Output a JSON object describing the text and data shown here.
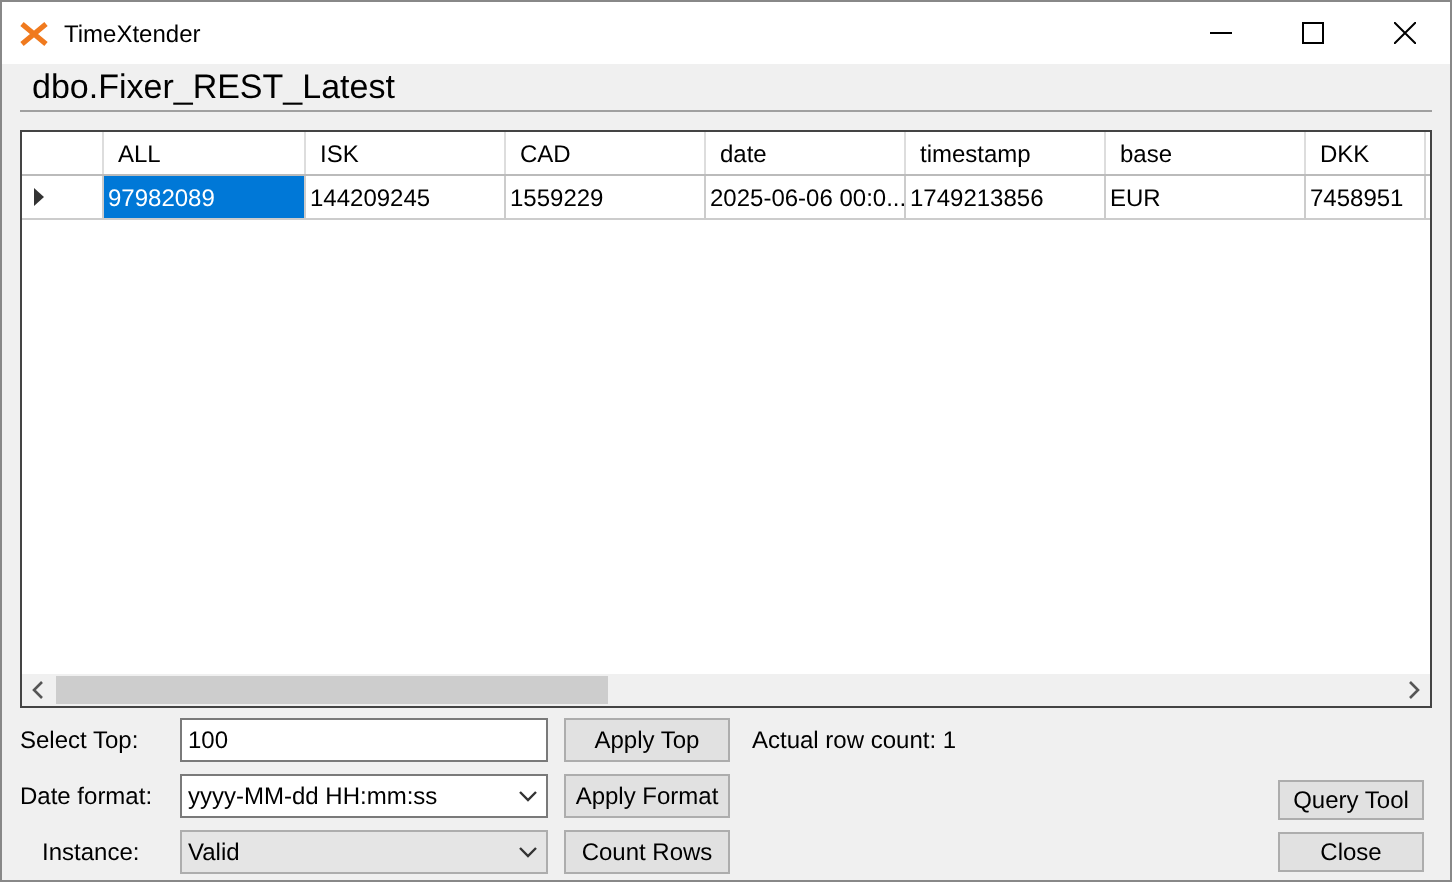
{
  "window": {
    "title": "TimeXtender"
  },
  "header": "dbo.Fixer_REST_Latest",
  "table": {
    "columns": [
      "ALL",
      "ISK",
      "CAD",
      "date",
      "timestamp",
      "base",
      "DKK"
    ],
    "rows": [
      {
        "current": true,
        "cells": [
          {
            "text": "97982089",
            "selected": true
          },
          {
            "text": "144209245",
            "selected": false
          },
          {
            "text": "1559229",
            "selected": false
          },
          {
            "text": "2025-06-06 00:0...",
            "selected": false
          },
          {
            "text": "1749213856",
            "selected": false
          },
          {
            "text": "EUR",
            "selected": false
          },
          {
            "text": "7458951",
            "selected": false
          }
        ]
      }
    ]
  },
  "controls": [
    {
      "label": "Select Top:",
      "kind": "text",
      "value": "100",
      "button": "Apply Top",
      "note": "Actual row count: 1"
    },
    {
      "label": "Date format:",
      "kind": "combo",
      "value": "yyyy-MM-dd HH:mm:ss",
      "button": "Apply Format"
    },
    {
      "label": "Instance:",
      "kind": "dropdown",
      "value": "Valid",
      "button": "Count Rows"
    }
  ],
  "side_buttons": [
    "Query Tool",
    "Close"
  ]
}
